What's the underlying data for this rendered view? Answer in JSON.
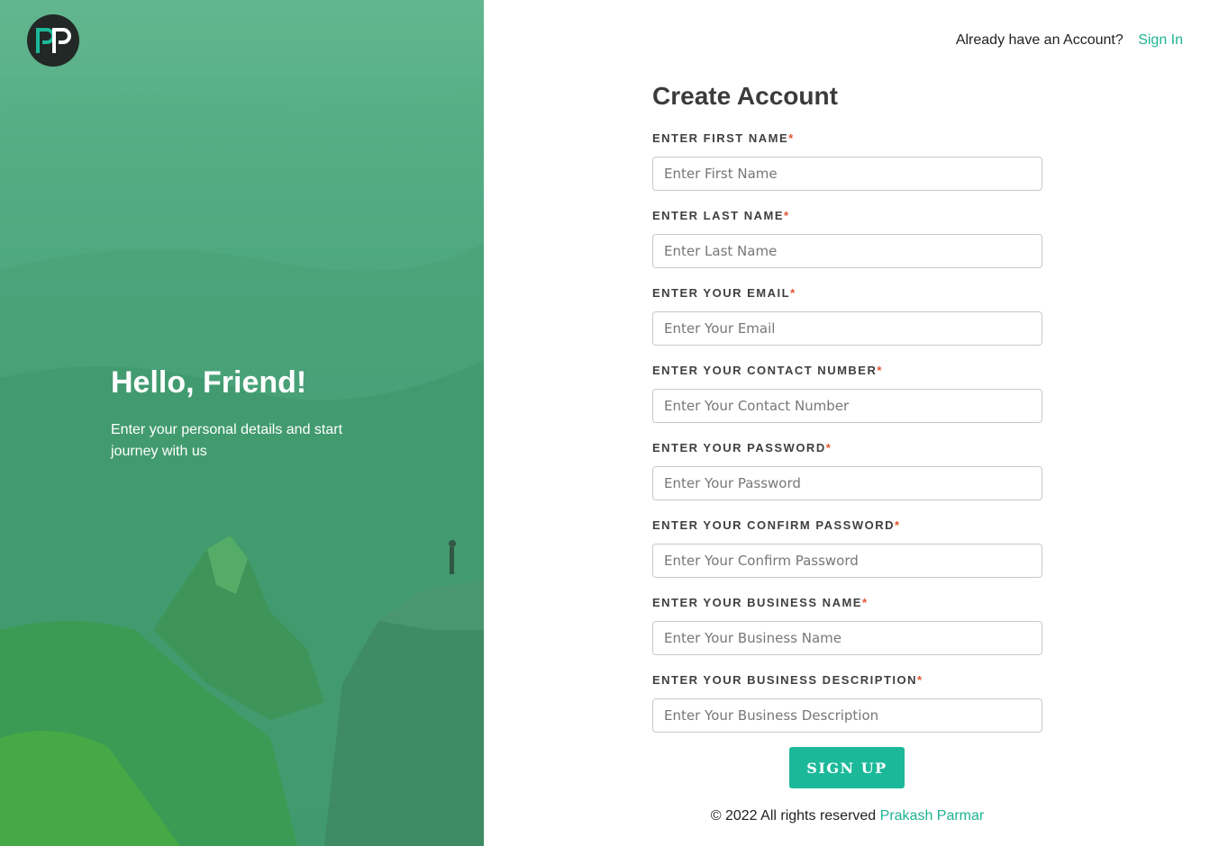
{
  "brand": {
    "logo_text": "PP",
    "icon": "pp-logo-icon"
  },
  "hero": {
    "title": "Hello, Friend!",
    "subtitle": "Enter your personal details and start journey with us"
  },
  "header": {
    "question": "Already have an Account?",
    "signin_label": "Sign In"
  },
  "form": {
    "title": "Create Account",
    "required_mark": "*",
    "fields": [
      {
        "label": "ENTER FIRST NAME",
        "placeholder": "Enter First Name",
        "value": ""
      },
      {
        "label": "ENTER LAST NAME",
        "placeholder": "Enter Last Name",
        "value": ""
      },
      {
        "label": "ENTER YOUR EMAIL",
        "placeholder": "Enter Your Email",
        "value": ""
      },
      {
        "label": "ENTER YOUR CONTACT NUMBER",
        "placeholder": "Enter Your Contact Number",
        "value": ""
      },
      {
        "label": "ENTER YOUR PASSWORD",
        "placeholder": "Enter Your Password",
        "value": ""
      },
      {
        "label": "ENTER YOUR CONFIRM PASSWORD",
        "placeholder": "Enter Your Confirm Password",
        "value": ""
      },
      {
        "label": "ENTER YOUR BUSINESS NAME",
        "placeholder": "Enter Your Business Name",
        "value": ""
      },
      {
        "label": "ENTER YOUR BUSINESS DESCRIPTION",
        "placeholder": "Enter Your Business Description",
        "value": ""
      }
    ],
    "submit_label": "SIGN UP"
  },
  "footer": {
    "text": "© 2022 All rights reserved",
    "author": "Prakash Parmar"
  },
  "colors": {
    "accent": "#1bb99a",
    "required": "#e0542b",
    "hero_green": "#4aa57c"
  }
}
